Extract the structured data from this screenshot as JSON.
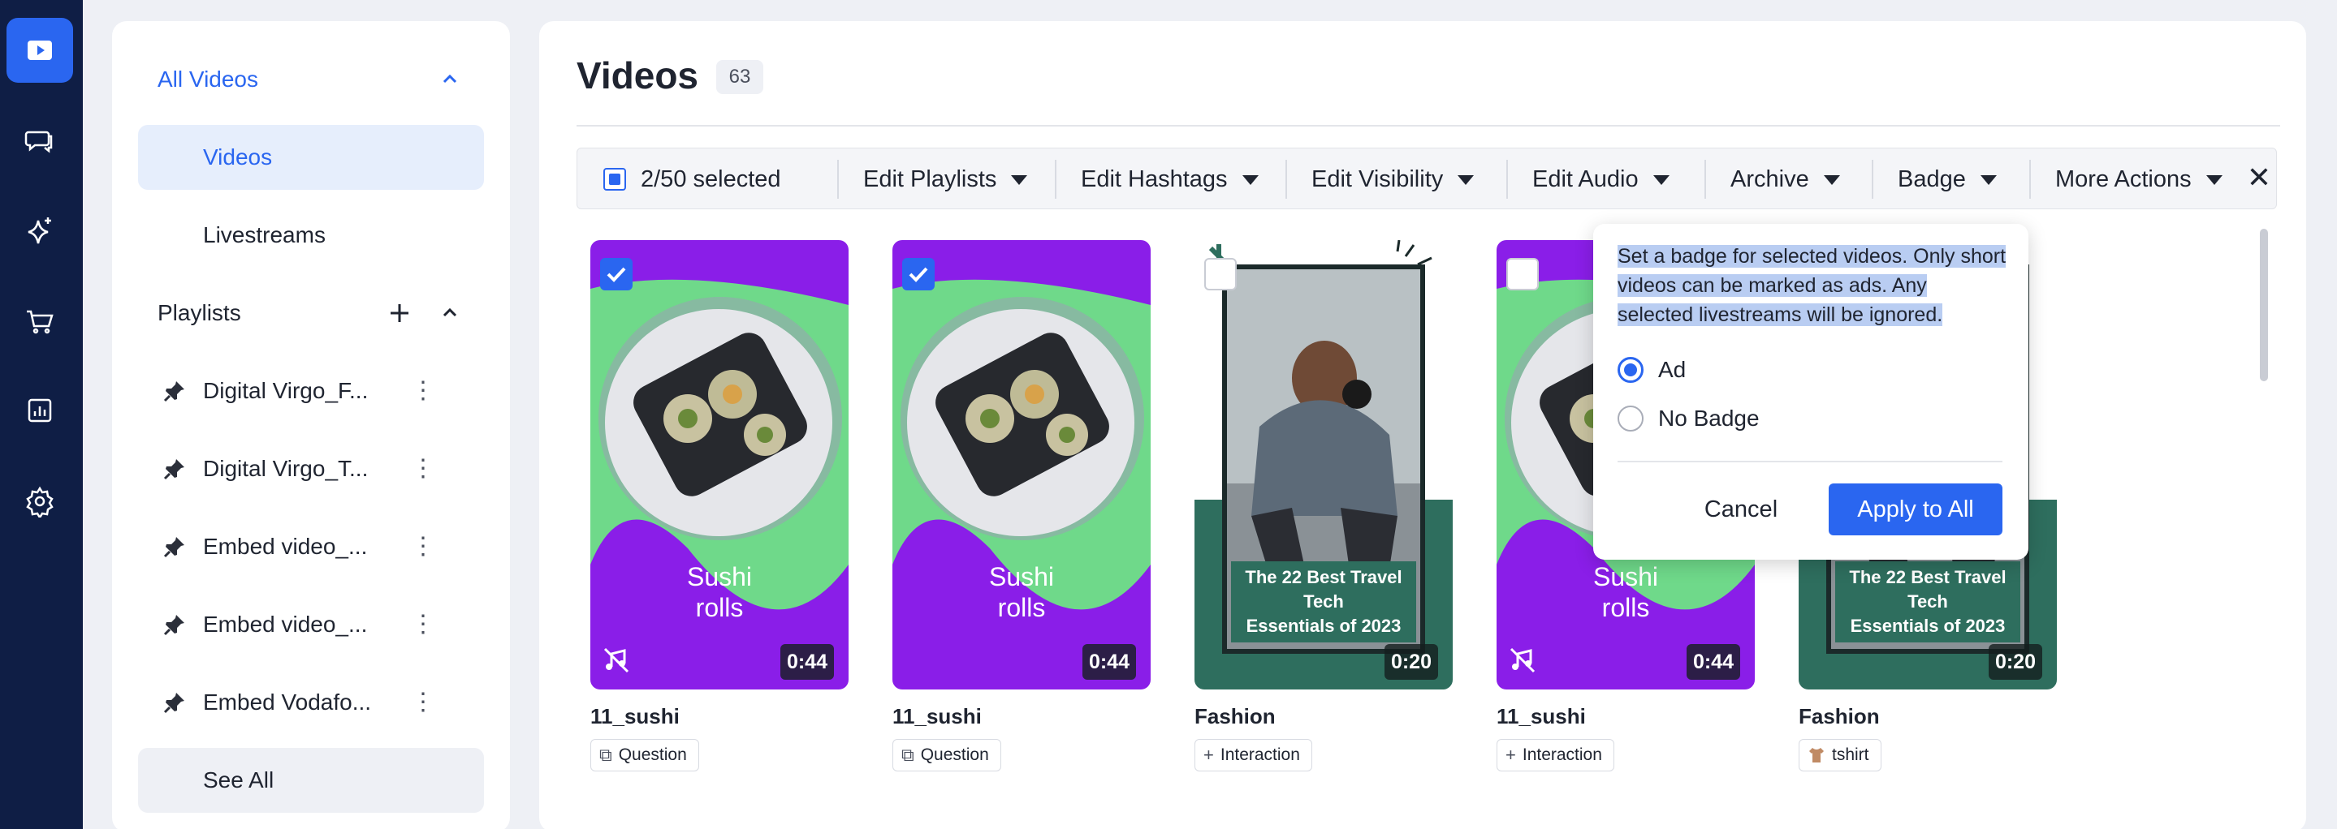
{
  "nav": {
    "items": [
      {
        "name": "videos-nav",
        "icon": "play-icon",
        "active": true
      },
      {
        "name": "messages-nav",
        "icon": "chat-icon",
        "active": false
      },
      {
        "name": "ai-nav",
        "icon": "sparkle-icon",
        "active": false
      },
      {
        "name": "shop-nav",
        "icon": "cart-icon",
        "active": false
      },
      {
        "name": "analytics-nav",
        "icon": "chart-icon",
        "active": false
      },
      {
        "name": "settings-nav",
        "icon": "gear-icon",
        "active": false
      }
    ]
  },
  "sidebar": {
    "all_videos": "All Videos",
    "videos": "Videos",
    "livestreams": "Livestreams",
    "playlists": "Playlists",
    "playlist_items": [
      {
        "label": "Digital Virgo_F..."
      },
      {
        "label": "Digital Virgo_T..."
      },
      {
        "label": "Embed video_..."
      },
      {
        "label": "Embed video_..."
      },
      {
        "label": "Embed Vodafo..."
      }
    ],
    "see_all": "See All"
  },
  "main": {
    "title": "Videos",
    "count": "63",
    "toolbar": {
      "selected": "2/50 selected",
      "edit_playlists": "Edit Playlists",
      "edit_hashtags": "Edit Hashtags",
      "edit_visibility": "Edit Visibility",
      "edit_audio": "Edit Audio",
      "archive": "Archive",
      "badge": "Badge",
      "more_actions": "More Actions",
      "close": "✕"
    },
    "videos": [
      {
        "name": "11_sushi",
        "duration": "0:44",
        "tag": "Question",
        "selected": true,
        "overlay": [
          "Sushi",
          "rolls"
        ]
      },
      {
        "name": "11_sushi",
        "duration": "0:44",
        "tag": "Question",
        "selected": true,
        "overlay": [
          "Sushi",
          "rolls"
        ]
      },
      {
        "name": "Fashion",
        "duration": "0:20",
        "tag": "Interaction",
        "selected": false,
        "overlay": [
          "The 22 Best Travel Tech",
          "Essentials of 2023"
        ]
      },
      {
        "name": "11_sushi",
        "duration": "0:44",
        "tag": "Interaction",
        "selected": false,
        "overlay": [
          "Sushi",
          "rolls"
        ]
      },
      {
        "name": "Fashion",
        "duration": "0:20",
        "tag": "tshirt",
        "selected": false,
        "overlay": [
          "The 22 Best Travel Tech",
          "Essentials of 2023"
        ]
      }
    ]
  },
  "popover": {
    "description": "Set a badge for selected videos. Only short videos can be marked as ads. Any selected livestreams will be ignored.",
    "option_ad": "Ad",
    "option_no_badge": "No Badge",
    "selected_option": "Ad",
    "cancel": "Cancel",
    "apply": "Apply to All"
  },
  "colors": {
    "accent": "#2a66f0",
    "rail": "#0f1e45",
    "sushi_purple": "#8a1ee8",
    "sushi_green": "#6fd98a",
    "travel_green": "#2e6e5e"
  }
}
